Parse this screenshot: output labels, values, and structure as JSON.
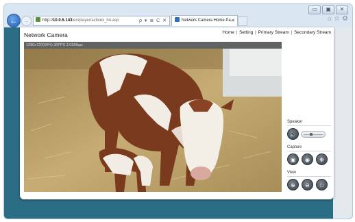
{
  "browser": {
    "address": {
      "scheme": "http://",
      "host": "10.0.5.143",
      "path": "/en/player/activex_h4.asp",
      "tools": "ρ ▾ ≣ C ✕"
    },
    "tab": {
      "title": "Network Camera Home Pa...",
      "close": "✕"
    },
    "window_controls": [
      "▭",
      "▣",
      "✕"
    ],
    "ie_tools": [
      "⌂",
      "☆",
      "⚙"
    ]
  },
  "page": {
    "brand": "Network Camera",
    "menu": [
      "Home",
      "Setting",
      "Primary Stream",
      "Secondary Stream"
    ],
    "menu_separator": "|",
    "stream_info": "1280x720(60%) 30FPS 2.05Mbps"
  },
  "controls": {
    "speaker_label": "Speaker",
    "capture_label": "Capture",
    "view_label": "View",
    "speaker_icon": "speaker-icon",
    "volume": 0.35,
    "capture_buttons": [
      "snapshot-icon",
      "record-icon",
      "settings-icon"
    ],
    "view_buttons": [
      "zoom-in-icon",
      "zoom-out-icon",
      "fullscreen-icon"
    ]
  },
  "colors": {
    "accent": "#2a6d84",
    "button": "#4a5158"
  }
}
